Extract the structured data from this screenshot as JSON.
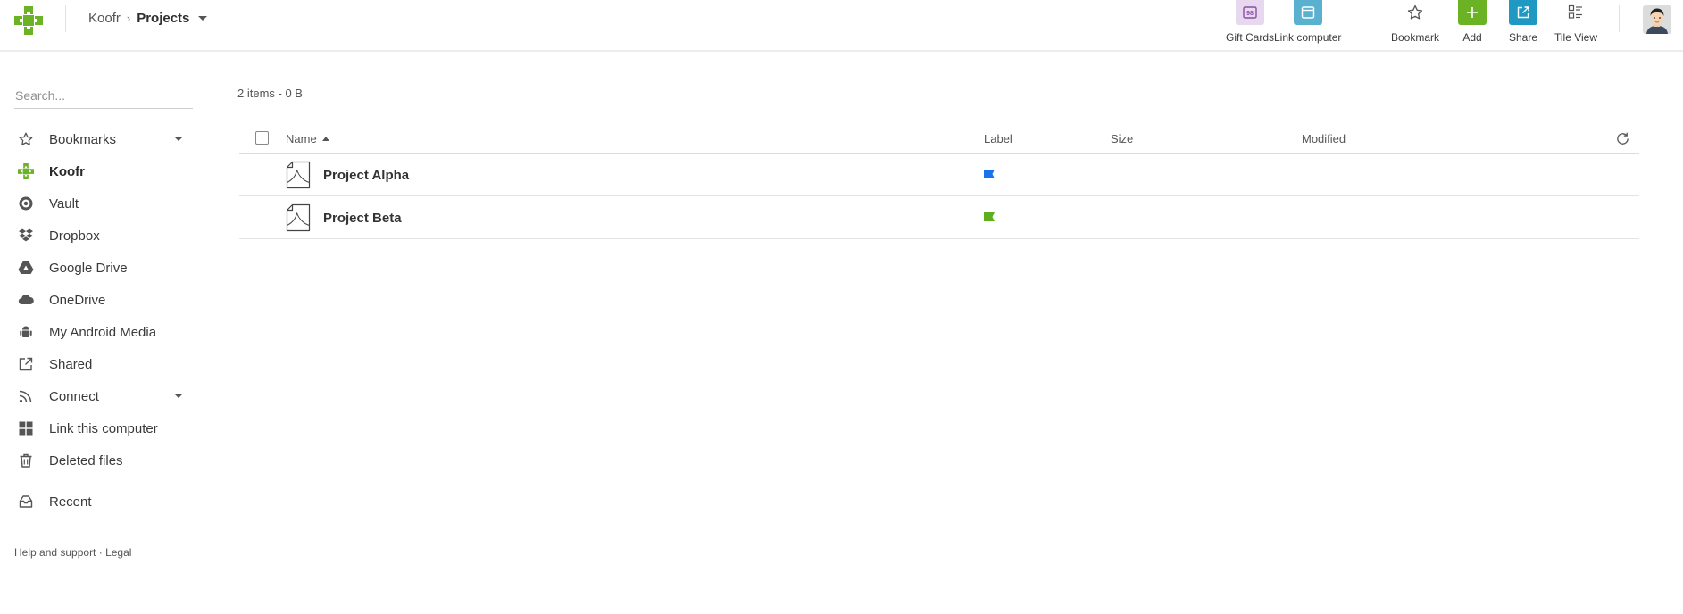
{
  "header": {
    "breadcrumb": {
      "root": "Koofr",
      "separator": "›",
      "current": "Projects"
    },
    "toolbar": [
      {
        "name": "gift-cards-button",
        "label": "Gift Cards",
        "icon": "gift-card-icon",
        "bg": "#e7d8ef",
        "fg": "#8a4fa5"
      },
      {
        "name": "link-computer-button",
        "label": "Link computer",
        "icon": "window-icon",
        "bg": "#5ab1cf",
        "fg": "#ffffff"
      },
      {
        "name": "bookmark-button",
        "label": "Bookmark",
        "icon": "star-outline-icon",
        "bg": "transparent",
        "fg": "#555555"
      },
      {
        "name": "add-button",
        "label": "Add",
        "icon": "plus-icon",
        "bg": "#6bb224",
        "fg": "#ffffff"
      },
      {
        "name": "share-button",
        "label": "Share",
        "icon": "share-icon",
        "bg": "#1f98c2",
        "fg": "#ffffff"
      },
      {
        "name": "tile-view-button",
        "label": "Tile View",
        "icon": "tile-view-icon",
        "bg": "transparent",
        "fg": "#555555"
      }
    ]
  },
  "sidebar": {
    "search_placeholder": "Search...",
    "items": [
      {
        "name": "bookmarks",
        "label": "Bookmarks",
        "icon": "star-outline-icon",
        "caret": true
      },
      {
        "name": "koofr",
        "label": "Koofr",
        "icon": "koofr-logo-icon",
        "active": true
      },
      {
        "name": "vault",
        "label": "Vault",
        "icon": "vault-icon"
      },
      {
        "name": "dropbox",
        "label": "Dropbox",
        "icon": "dropbox-icon"
      },
      {
        "name": "google-drive",
        "label": "Google Drive",
        "icon": "google-drive-icon"
      },
      {
        "name": "onedrive",
        "label": "OneDrive",
        "icon": "cloud-icon"
      },
      {
        "name": "my-android-media",
        "label": "My Android Media",
        "icon": "android-icon"
      },
      {
        "name": "shared",
        "label": "Shared",
        "icon": "share-outline-icon"
      },
      {
        "name": "connect",
        "label": "Connect",
        "icon": "rss-icon",
        "caret": true
      },
      {
        "name": "link-this-computer",
        "label": "Link this computer",
        "icon": "windows-icon"
      },
      {
        "name": "deleted-files",
        "label": "Deleted files",
        "icon": "trash-icon"
      },
      {
        "name": "recent",
        "label": "Recent",
        "icon": "recent-icon"
      }
    ],
    "footer": {
      "help": "Help and support",
      "dot": " · ",
      "legal": "Legal"
    }
  },
  "main": {
    "summary": "2 items - 0 B",
    "columns": {
      "name": "Name",
      "label": "Label",
      "size": "Size",
      "modified": "Modified"
    },
    "rows": [
      {
        "name": "Project Alpha",
        "label_color": "#1a73e8",
        "size": "",
        "modified": ""
      },
      {
        "name": "Project Beta",
        "label_color": "#5fae1d",
        "size": "",
        "modified": ""
      }
    ]
  },
  "colors": {
    "brand_green": "#6bb224"
  }
}
